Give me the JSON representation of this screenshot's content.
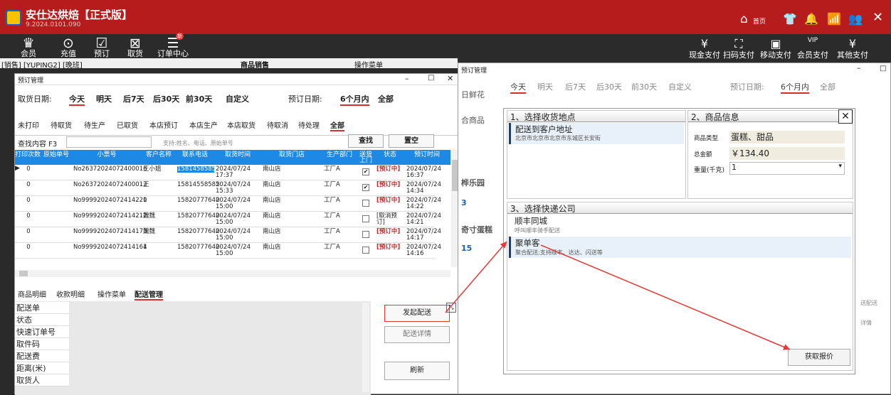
{
  "app": {
    "title": "安仕达烘焙【正式版】",
    "version": "9.2024.0101.090"
  },
  "toolbar_left": [
    {
      "icon": "crown-icon",
      "glyph": "♛",
      "label": "会员"
    },
    {
      "icon": "recharge-icon",
      "glyph": "⊙",
      "label": "充值"
    },
    {
      "icon": "calendar-check-icon",
      "glyph": "☑",
      "label": "预订"
    },
    {
      "icon": "pickup-icon",
      "glyph": "⊠",
      "label": "取货"
    },
    {
      "icon": "order-center-icon",
      "glyph": "☰",
      "label": "订单中心",
      "badge": "新"
    }
  ],
  "toolbar_right": [
    {
      "icon": "cash-icon",
      "glyph": "¥",
      "label": "现金支付"
    },
    {
      "icon": "scan-icon",
      "glyph": "⛶",
      "label": "扫码支付"
    },
    {
      "icon": "mobile-pay-icon",
      "glyph": "▣",
      "label": "移动支付"
    },
    {
      "icon": "vip-icon",
      "glyph": "VIP",
      "label": "会员支付"
    },
    {
      "icon": "other-pay-icon",
      "glyph": "¥",
      "label": "其他支付"
    }
  ],
  "top_icons": {
    "home": "首页"
  },
  "subbar": {
    "left": "[销售] [YUPING2] [晚班]",
    "mid": "商品销售",
    "right": "操作菜单"
  },
  "winA": {
    "title": "预订管理",
    "pickup_label": "取货日期:",
    "date_opts": [
      "今天",
      "明天",
      "后7天",
      "后30天",
      "前30天",
      "自定义"
    ],
    "book_label": "预订日期:",
    "book_opts": [
      "6个月内",
      "全部"
    ],
    "status_tabs": [
      "未打印",
      "待取货",
      "待生产",
      "已取货",
      "本店预订",
      "本店生产",
      "本店取货",
      "待取消",
      "待处理",
      "全部"
    ],
    "search_label": "查找内容 F3",
    "search_hint": "支持:姓名、电话、原始单号",
    "search_btn": "查找",
    "clear_btn": "置空",
    "columns": [
      "打印次数",
      "原始单号",
      "小票号",
      "客户名称",
      "联系电话",
      "取货时间",
      "取货门店",
      "生产部门",
      "送货上门",
      "状态",
      "预订时间"
    ],
    "rows": [
      [
        "0",
        "",
        "No26372024072400016",
        "王小姐",
        "15814585858",
        "2024/07/24 17:37",
        "南山店",
        "工厂A",
        "✔",
        "[预订中]",
        "2024/07/24 16:37"
      ],
      [
        "0",
        "",
        "No26372024072400012",
        "王",
        "15814558585",
        "2024/07/24 15:33",
        "南山店",
        "工厂A",
        "✔",
        "[预订中]",
        "2024/07/24 14:34"
      ],
      [
        "0",
        "",
        "No99992024072414220",
        "1",
        "15820777640",
        "2024/07/24 15:00",
        "南山店",
        "工厂A",
        "",
        "[预订中]",
        "2024/07/24 14:22"
      ],
      [
        "0",
        "",
        "No99992024072414212",
        "魏魏",
        "15820777640",
        "2024/07/24 15:00",
        "南山店",
        "工厂A",
        "",
        "[取消预订]",
        "2024/07/24 14:21"
      ],
      [
        "0",
        "",
        "No99992024072414173",
        "魏魏",
        "15820777640",
        "2024/07/24 15:00",
        "南山店",
        "工厂A",
        "",
        "[预订中]",
        "2024/07/24 14:17"
      ],
      [
        "0",
        "",
        "No99992024072414164",
        "1",
        "15820777640",
        "2024/07/24 15:00",
        "南山店",
        "工厂A",
        "",
        "[预订中]",
        "2024/07/24 14:16"
      ]
    ],
    "bottom_tabs": [
      "商品明细",
      "收款明细",
      "操作菜单",
      "配送管理"
    ],
    "detail_labels": [
      "配送单",
      "状态",
      "快速订单号",
      "取件码",
      "配送费",
      "距离(米)",
      "取货人"
    ],
    "btn_send": "发起配送",
    "btn_detail": "配送详情",
    "btn_refresh": "刷新"
  },
  "winB": {
    "title": "预订管理",
    "date_opts": [
      "今天",
      "明天",
      "后7天",
      "后30天",
      "前30天",
      "自定义"
    ],
    "book_label": "预订日期:",
    "book_opts": [
      "6个月内",
      "全部"
    ],
    "left_frag": [
      "日鲜花",
      "合商品",
      "桦乐园",
      "3",
      "奇寸蛋糕",
      "15"
    ],
    "sec1_title": "1、选择收货地点",
    "addr_title": "配送到客户地址",
    "addr_text": "北京市北京市北京市东城区长安街",
    "sec2_title": "2、商品信息",
    "goods_type_label": "商品类型",
    "goods_type": "蛋糕、甜品",
    "total_label": "总金额",
    "total": "￥134.40",
    "weight_label": "重量(千克)",
    "weight": "1",
    "sec3_title": "3、选择快递公司",
    "c1_name": "顺丰同城",
    "c1_desc": "呼叫顺丰骑手配送",
    "c2_name": "聚单客",
    "c2_desc": "聚合配送;支持顺丰、达达、闪送等",
    "quote_btn": "获取报价",
    "right_frag": [
      "送配送",
      "详情"
    ]
  }
}
